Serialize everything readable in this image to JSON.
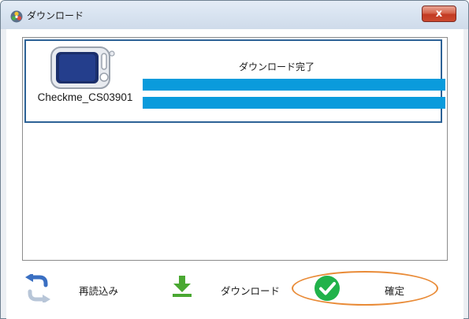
{
  "window": {
    "title": "ダウンロード",
    "close_label": "x"
  },
  "device_list": {
    "items": [
      {
        "device_name": "Checkme_CS03901",
        "status": "ダウンロード完了",
        "progress": 1.0
      }
    ]
  },
  "actions": {
    "reload_label": "再読込み",
    "download_label": "ダウンロード",
    "confirm_label": "確定"
  },
  "icons": {
    "app": "app-logo-icon",
    "device": "device-icon",
    "reload": "reload-icon",
    "download": "download-icon",
    "confirm": "checkmark-icon",
    "close": "close-icon"
  },
  "colors": {
    "progress": "#0a9bdc",
    "selection_border": "#2d6296",
    "confirm_icon": "#21b24a",
    "download_icon": "#4aa832",
    "highlight": "#e98b37",
    "close_button": "#c8442d"
  }
}
